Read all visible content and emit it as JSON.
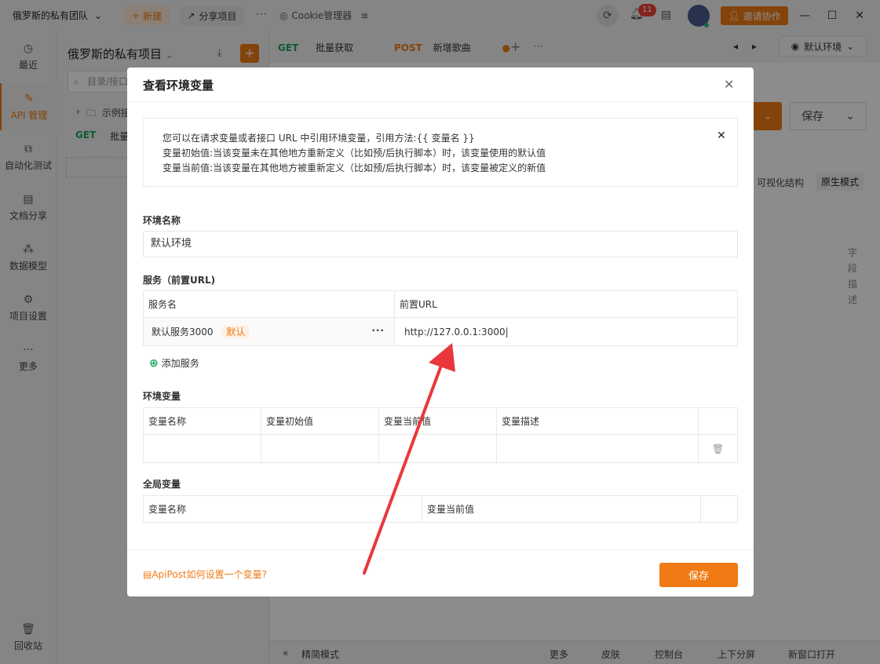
{
  "titlebar": {
    "team": "俄罗斯的私有团队",
    "new_label": "新建",
    "share_label": "分享项目",
    "cookie_label": "Cookie管理器",
    "notification_count": "11",
    "invite_label": "邀请协作"
  },
  "rail": {
    "items": [
      {
        "label": "最近",
        "icon": "clock-icon"
      },
      {
        "label": "API 管理",
        "icon": "api-icon"
      },
      {
        "label": "自动化测试",
        "icon": "flow-icon"
      },
      {
        "label": "文档分享",
        "icon": "doc-icon"
      },
      {
        "label": "数据模型",
        "icon": "model-icon"
      },
      {
        "label": "项目设置",
        "icon": "settings-icon"
      },
      {
        "label": "更多",
        "icon": "more-icon"
      }
    ],
    "trash_label": "回收站"
  },
  "panel": {
    "project_title": "俄罗斯的私有项目",
    "search_placeholder": "目录/接口",
    "tree_folder": "示例接",
    "tree_method": "GET",
    "tree_item": "批量"
  },
  "work": {
    "tab1_method": "GET",
    "tab1_label": "批量获取",
    "tab2_method": "POST",
    "tab2_label": "新增歌曲",
    "env_label": "默认环境",
    "save_label": "保存",
    "view_visual": "可视化结构",
    "view_raw": "原生模式",
    "field_desc": "字段描述"
  },
  "statusbar": {
    "simple_mode": "精简模式",
    "more": "更多",
    "skin": "皮肤",
    "console": "控制台",
    "split": "上下分屏",
    "new_window": "新窗口打开"
  },
  "modal": {
    "title": "查看环境变量",
    "notice": [
      "您可以在请求变量或者接口 URL 中引用环境变量，引用方法:{{ 变量名 }}",
      "变量初始值:当该变量未在其他地方重新定义（比如预/后执行脚本）时，该变量使用的默认值",
      "变量当前值:当该变量在其他地方被重新定义（比如预/后执行脚本）时，该变量被定义的新值"
    ],
    "env_name_label": "环境名称",
    "env_name_value": "默认环境",
    "service_label": "服务（前置URL)",
    "service_headers": [
      "服务名",
      "前置URL"
    ],
    "service_row": {
      "name": "默认服务3000",
      "tag": "默认",
      "url": "http://127.0.0.1:3000"
    },
    "add_service_label": "添加服务",
    "env_vars_label": "环境变量",
    "env_vars_headers": [
      "变量名称",
      "变量初始值",
      "变量当前值",
      "变量描述"
    ],
    "global_vars_label": "全局变量",
    "global_vars_headers": [
      "变量名称",
      "变量当前值"
    ],
    "help_link": "ApiPost如何设置一个变量?",
    "save_label": "保存"
  },
  "colors": {
    "accent": "#f07a14",
    "annotation_arrow": "#e8383d"
  }
}
